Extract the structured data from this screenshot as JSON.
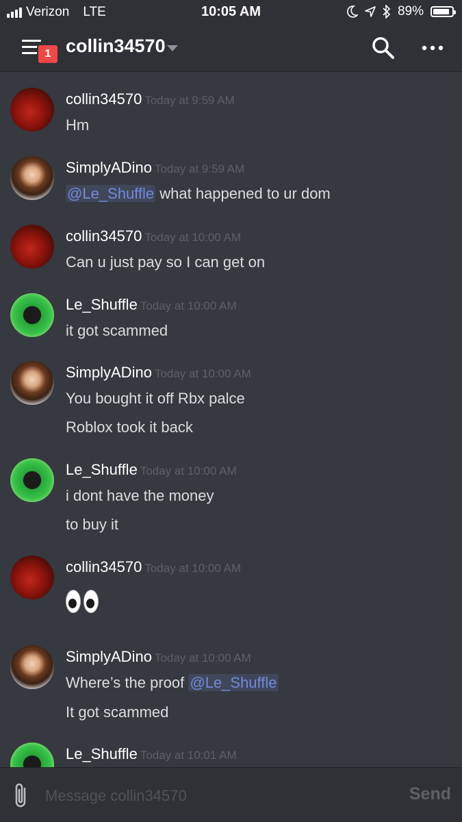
{
  "status_bar": {
    "carrier": "Verizon",
    "network": "LTE",
    "time": "10:05 AM",
    "battery": "89%",
    "battery_level": 0.89,
    "icons": [
      "moon-icon",
      "location-icon",
      "bluetooth-icon",
      "battery-icon"
    ]
  },
  "header": {
    "title": "collin34570",
    "badge_count": "1",
    "icons": [
      "menu-icon",
      "search-icon",
      "more-icon"
    ]
  },
  "messages": [
    {
      "author": "collin34570",
      "timestamp": "Today at 9:59 AM",
      "lines": [
        "Hm"
      ]
    },
    {
      "author": "SimplyADino",
      "timestamp": "Today at 9:59 AM",
      "mention": "@Le_Shuffle",
      "text_after": " what happened to ur dom"
    },
    {
      "author": "collin34570",
      "timestamp": "Today at 10:00 AM",
      "lines": [
        "Can u just pay so I can get on"
      ]
    },
    {
      "author": "Le_Shuffle",
      "timestamp": "Today at 10:00 AM",
      "lines": [
        "it got scammed"
      ]
    },
    {
      "author": "SimplyADino",
      "timestamp": "Today at 10:00 AM",
      "lines": [
        "You bought it off Rbx palce",
        "Roblox took it back"
      ]
    },
    {
      "author": "Le_Shuffle",
      "timestamp": "Today at 10:00 AM",
      "lines": [
        "i dont have the money",
        "to buy it"
      ]
    },
    {
      "author": "collin34570",
      "timestamp": "Today at 10:00 AM",
      "emoji": "eyes"
    },
    {
      "author": "SimplyADino",
      "timestamp": "Today at 10:00 AM",
      "text_before": "Where’s the proof ",
      "mention": "@Le_Shuffle",
      "lines": [
        "It got scammed"
      ]
    },
    {
      "author": "Le_Shuffle",
      "timestamp": "Today at 10:01 AM"
    }
  ],
  "input": {
    "placeholder": "Message collin34570",
    "send_label": "Send"
  },
  "colors": {
    "background": "#36393f",
    "header": "#2f3136",
    "mention": "#7289da",
    "badge": "#f04747"
  }
}
